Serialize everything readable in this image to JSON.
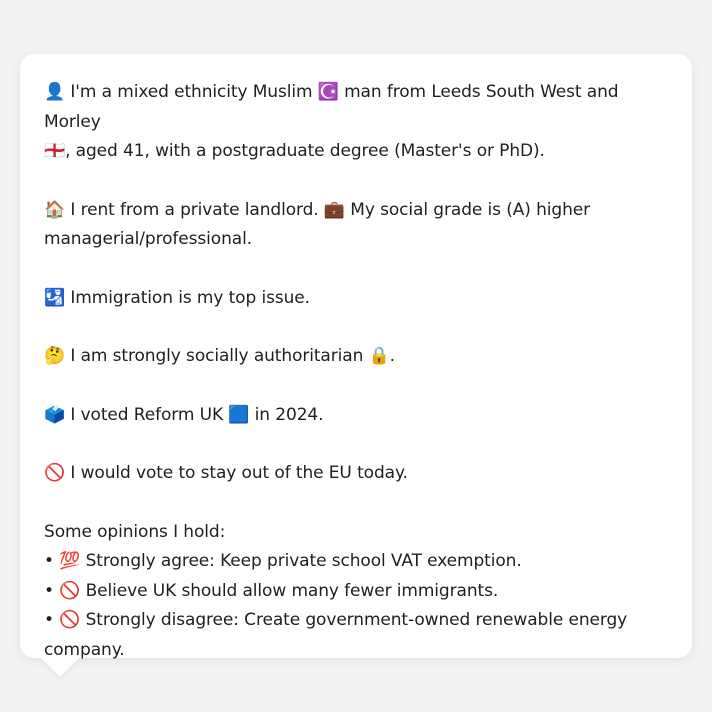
{
  "profile": {
    "intro_line1": "👤 I'm a mixed ethnicity Muslim ☪️ man from Leeds South West and Morley",
    "intro_line2": "🏴󠁧󠁢󠁥󠁮󠁧󠁿, aged 41, with a postgraduate degree (Master's or PhD).",
    "housing_line1": "🏠 I rent from a private landlord. 💼 My social grade is (A) higher",
    "housing_line2": "managerial/professional.",
    "top_issue": "🛂 Immigration is my top issue.",
    "social_view": "🤔 I am strongly socially authoritarian 🔒.",
    "vote_2024": "🗳️ I voted Reform UK 🟦 in 2024.",
    "eu_view": "🚫 I would vote to stay out of the EU today."
  },
  "opinions": {
    "heading": "Some opinions I hold:",
    "items": [
      "• 💯 Strongly agree: Keep private school VAT exemption.",
      "• 🚫 Believe UK should allow many fewer immigrants.",
      "• 🚫 Strongly disagree: Create government-owned renewable energy"
    ],
    "item3_continuation": "company."
  }
}
